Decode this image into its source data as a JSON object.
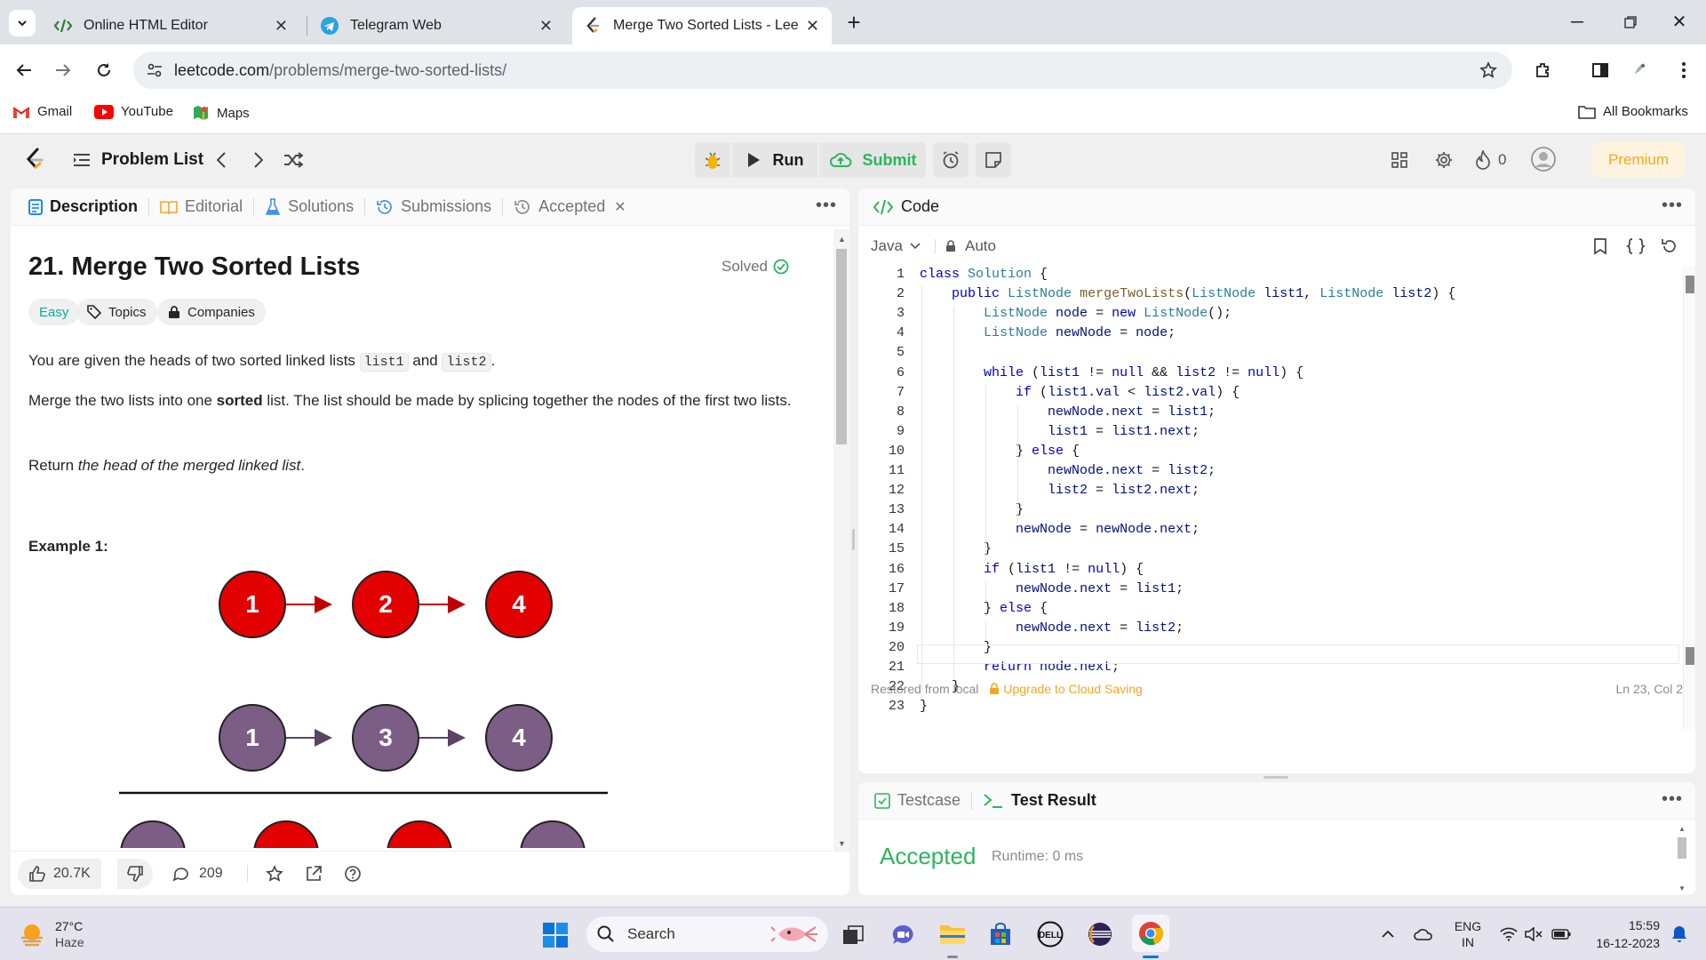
{
  "browser": {
    "tabs": [
      {
        "title": "Online HTML Editor",
        "icon": "code-icon"
      },
      {
        "title": "Telegram Web",
        "icon": "telegram-icon"
      },
      {
        "title": "Merge Two Sorted Lists - LeetC",
        "icon": "leetcode-icon",
        "active": true
      }
    ],
    "url_host": "leetcode.com",
    "url_path": "/problems/merge-two-sorted-lists/",
    "bookmarks": [
      "Gmail",
      "YouTube",
      "Maps"
    ],
    "all_bookmarks": "All Bookmarks"
  },
  "lc": {
    "problem_list": "Problem List",
    "run": "Run",
    "submit": "Submit",
    "streak": "0",
    "premium": "Premium"
  },
  "desc": {
    "tabs": [
      "Description",
      "Editorial",
      "Solutions",
      "Submissions",
      "Accepted"
    ],
    "title": "21. Merge Two Sorted Lists",
    "solved": "Solved",
    "difficulty": "Easy",
    "topics": "Topics",
    "companies": "Companies",
    "p1_a": "You are given the heads of two sorted linked lists ",
    "p1_code1": "list1",
    "p1_and": " and ",
    "p1_code2": "list2",
    "p1_end": ".",
    "p2_a": "Merge the two lists into one ",
    "p2_bold": "sorted",
    "p2_b": " list. The list should be made by splicing together the nodes of the first two lists.",
    "p3_a": "Return ",
    "p3_em": "the head of the merged linked list",
    "p3_end": ".",
    "example": "Example 1:",
    "list_a": [
      "1",
      "2",
      "4"
    ],
    "list_b": [
      "1",
      "3",
      "4"
    ],
    "likes": "20.7K",
    "comments": "209"
  },
  "code": {
    "header": "Code",
    "language": "Java",
    "mode": "Auto",
    "lines": [
      "class Solution {",
      "    public ListNode mergeTwoLists(ListNode list1, ListNode list2) {",
      "        ListNode node = new ListNode();",
      "        ListNode newNode = node;",
      "",
      "        while (list1 != null && list2 != null) {",
      "            if (list1.val < list2.val) {",
      "                newNode.next = list1;",
      "                list1 = list1.next;",
      "            } else {",
      "                newNode.next = list2;",
      "                list2 = list2.next;",
      "            }",
      "            newNode = newNode.next;",
      "        }",
      "        if (list1 != null) {",
      "            newNode.next = list1;",
      "        } else {",
      "            newNode.next = list2;",
      "        }",
      "        return node.next;",
      "    }",
      "}"
    ],
    "restored": "Restored from local",
    "upgrade": "Upgrade to Cloud Saving",
    "cursor": "Ln 23, Col 2"
  },
  "result": {
    "testcase": "Testcase",
    "test_result": "Test Result",
    "status": "Accepted",
    "runtime": "Runtime: 0 ms"
  },
  "taskbar": {
    "temp": "27°C",
    "weather": "Haze",
    "search": "Search",
    "lang1": "ENG",
    "lang2": "IN",
    "time": "15:59",
    "date": "16-12-2023"
  },
  "colors": {
    "accent_green": "#2db55d",
    "premium": "#f5a623",
    "node_red": "#e30000",
    "node_purple": "#7b5d86"
  }
}
